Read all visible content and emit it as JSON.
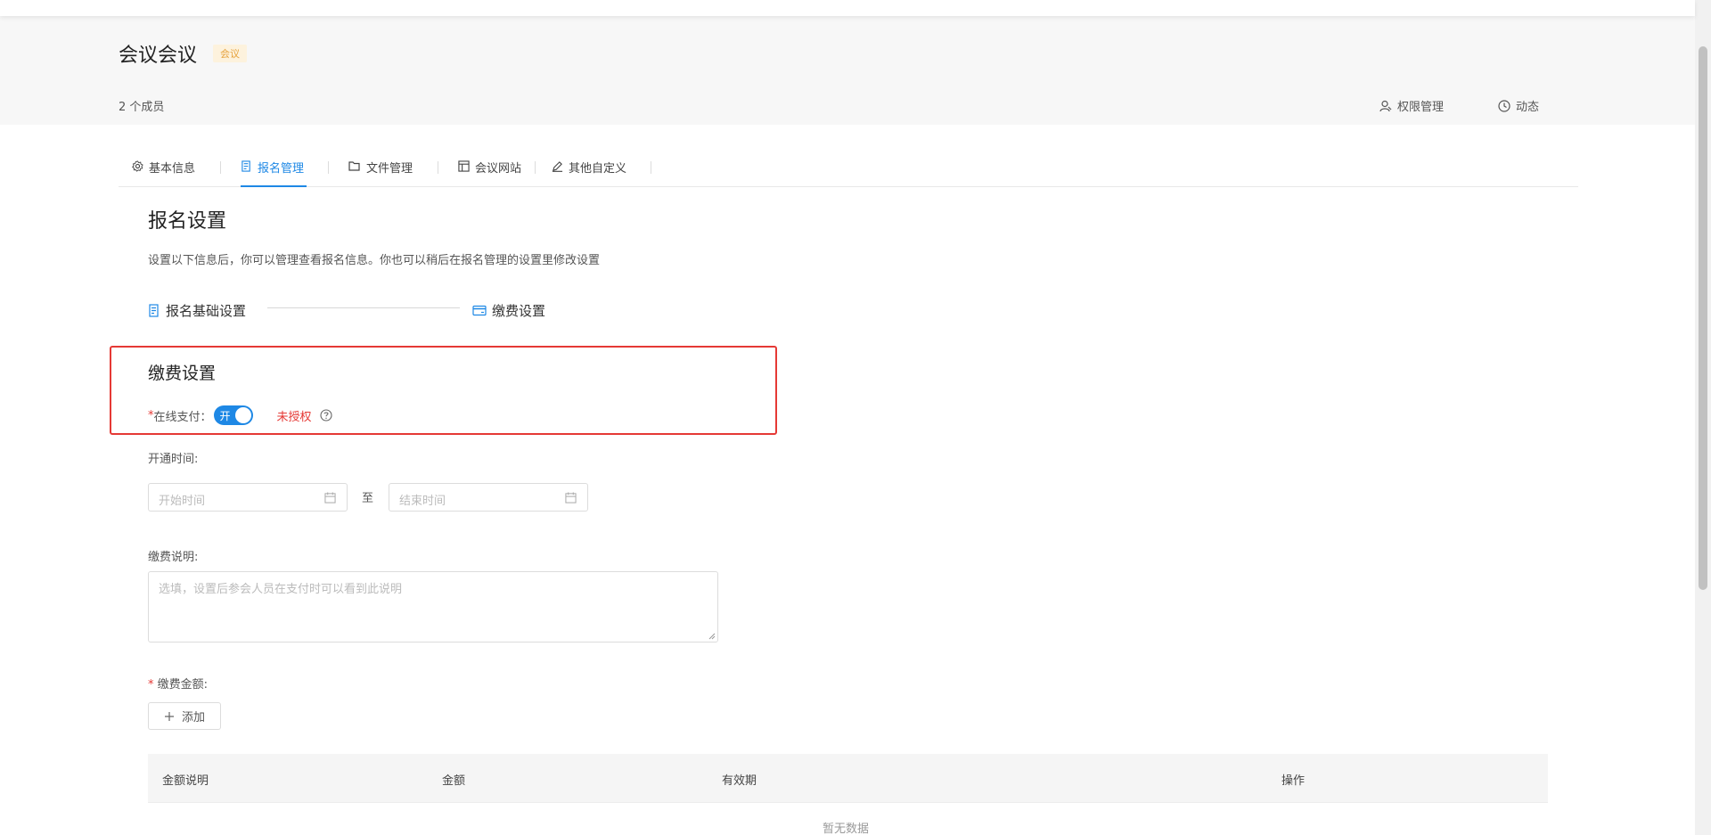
{
  "header": {
    "title": "会议会议",
    "badge": "会议",
    "members": "2 个成员",
    "actions": [
      {
        "label": "权限管理",
        "icon": "user-permission-icon"
      },
      {
        "label": "动态",
        "icon": "clock-icon"
      }
    ]
  },
  "tabs": [
    {
      "label": "基本信息",
      "icon": "gear-icon"
    },
    {
      "label": "报名管理",
      "icon": "registration-icon",
      "active": true
    },
    {
      "label": "文件管理",
      "icon": "folder-icon"
    },
    {
      "label": "会议网站",
      "icon": "website-icon"
    },
    {
      "label": "其他自定义",
      "icon": "edit-icon"
    }
  ],
  "registration": {
    "title": "报名设置",
    "description": "设置以下信息后，你可以管理查看报名信息。你也可以稍后在报名管理的设置里修改设置",
    "steps": [
      {
        "label": "报名基础设置",
        "icon": "registration-icon"
      },
      {
        "label": "缴费设置",
        "icon": "card-icon"
      }
    ]
  },
  "payment": {
    "title": "缴费设置",
    "online_pay_required": "*",
    "online_pay_label": "在线支付：",
    "switch_text": "开",
    "unauthorized": "未授权",
    "open_time_label": "开通时间:",
    "start_placeholder": "开始时间",
    "to": "至",
    "end_placeholder": "结束时间",
    "desc_label": "缴费说明:",
    "desc_placeholder": "选填，设置后参会人员在支付时可以看到此说明",
    "amount_required": "*",
    "amount_label": " 缴费金额:",
    "add_button": "添加"
  },
  "table": {
    "columns": [
      "金额说明",
      "金额",
      "有效期",
      "操作"
    ],
    "empty": "暂无数据"
  },
  "colors": {
    "accent": "#1e88e5",
    "danger": "#e53935",
    "badge_text": "#e6a23c"
  }
}
